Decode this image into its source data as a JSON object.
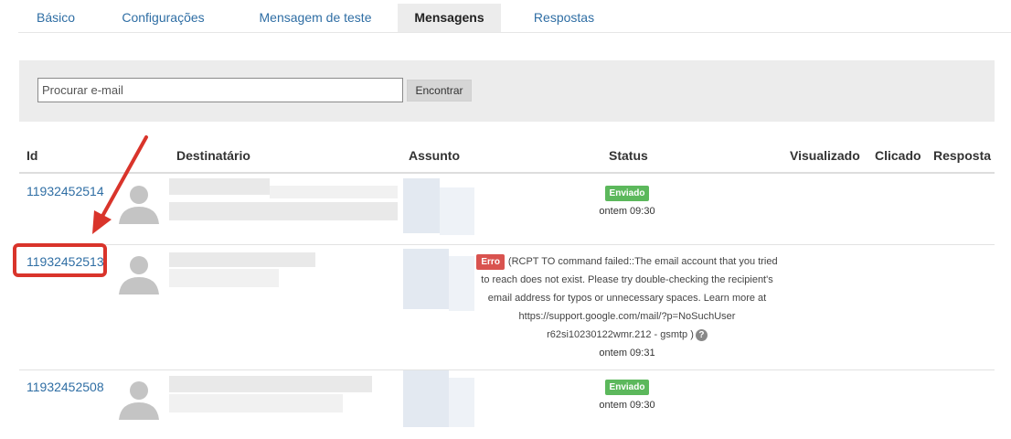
{
  "tabs": [
    {
      "label": "Básico"
    },
    {
      "label": "Configurações"
    },
    {
      "label": "Mensagem de teste"
    },
    {
      "label": "Mensagens"
    },
    {
      "label": "Respostas"
    }
  ],
  "search": {
    "placeholder": "Procurar e-mail",
    "button_label": "Encontrar"
  },
  "table": {
    "headers": {
      "id": "Id",
      "recipient": "Destinatário",
      "subject": "Assunto",
      "status": "Status",
      "viewed": "Visualizado",
      "clicked": "Clicado",
      "response": "Resposta"
    },
    "rows": [
      {
        "id": "11932452514",
        "badge": "Enviado",
        "time": "ontem 09:30"
      },
      {
        "id": "11932452513",
        "badge": "Erro",
        "error_message": "(RCPT TO command failed::The email account that you tried to reach does not exist. Please try double-checking the recipient's email address for typos or unnecessary spaces. Learn more at https://support.google.com/mail/?p=NoSuchUser r62si10230122wmr.212 - gsmtp )",
        "time": "ontem 09:31"
      },
      {
        "id": "11932452508",
        "badge": "Enviado",
        "time": "ontem 09:30"
      }
    ]
  },
  "colors": {
    "link": "#2f6ea4",
    "success": "#5cb85c",
    "error": "#d9534f",
    "annotation": "#d9342b"
  },
  "icons": {
    "avatar": "user-silhouette-icon",
    "help": "question-circle-icon",
    "annotation_arrow": "red-arrow-icon"
  }
}
